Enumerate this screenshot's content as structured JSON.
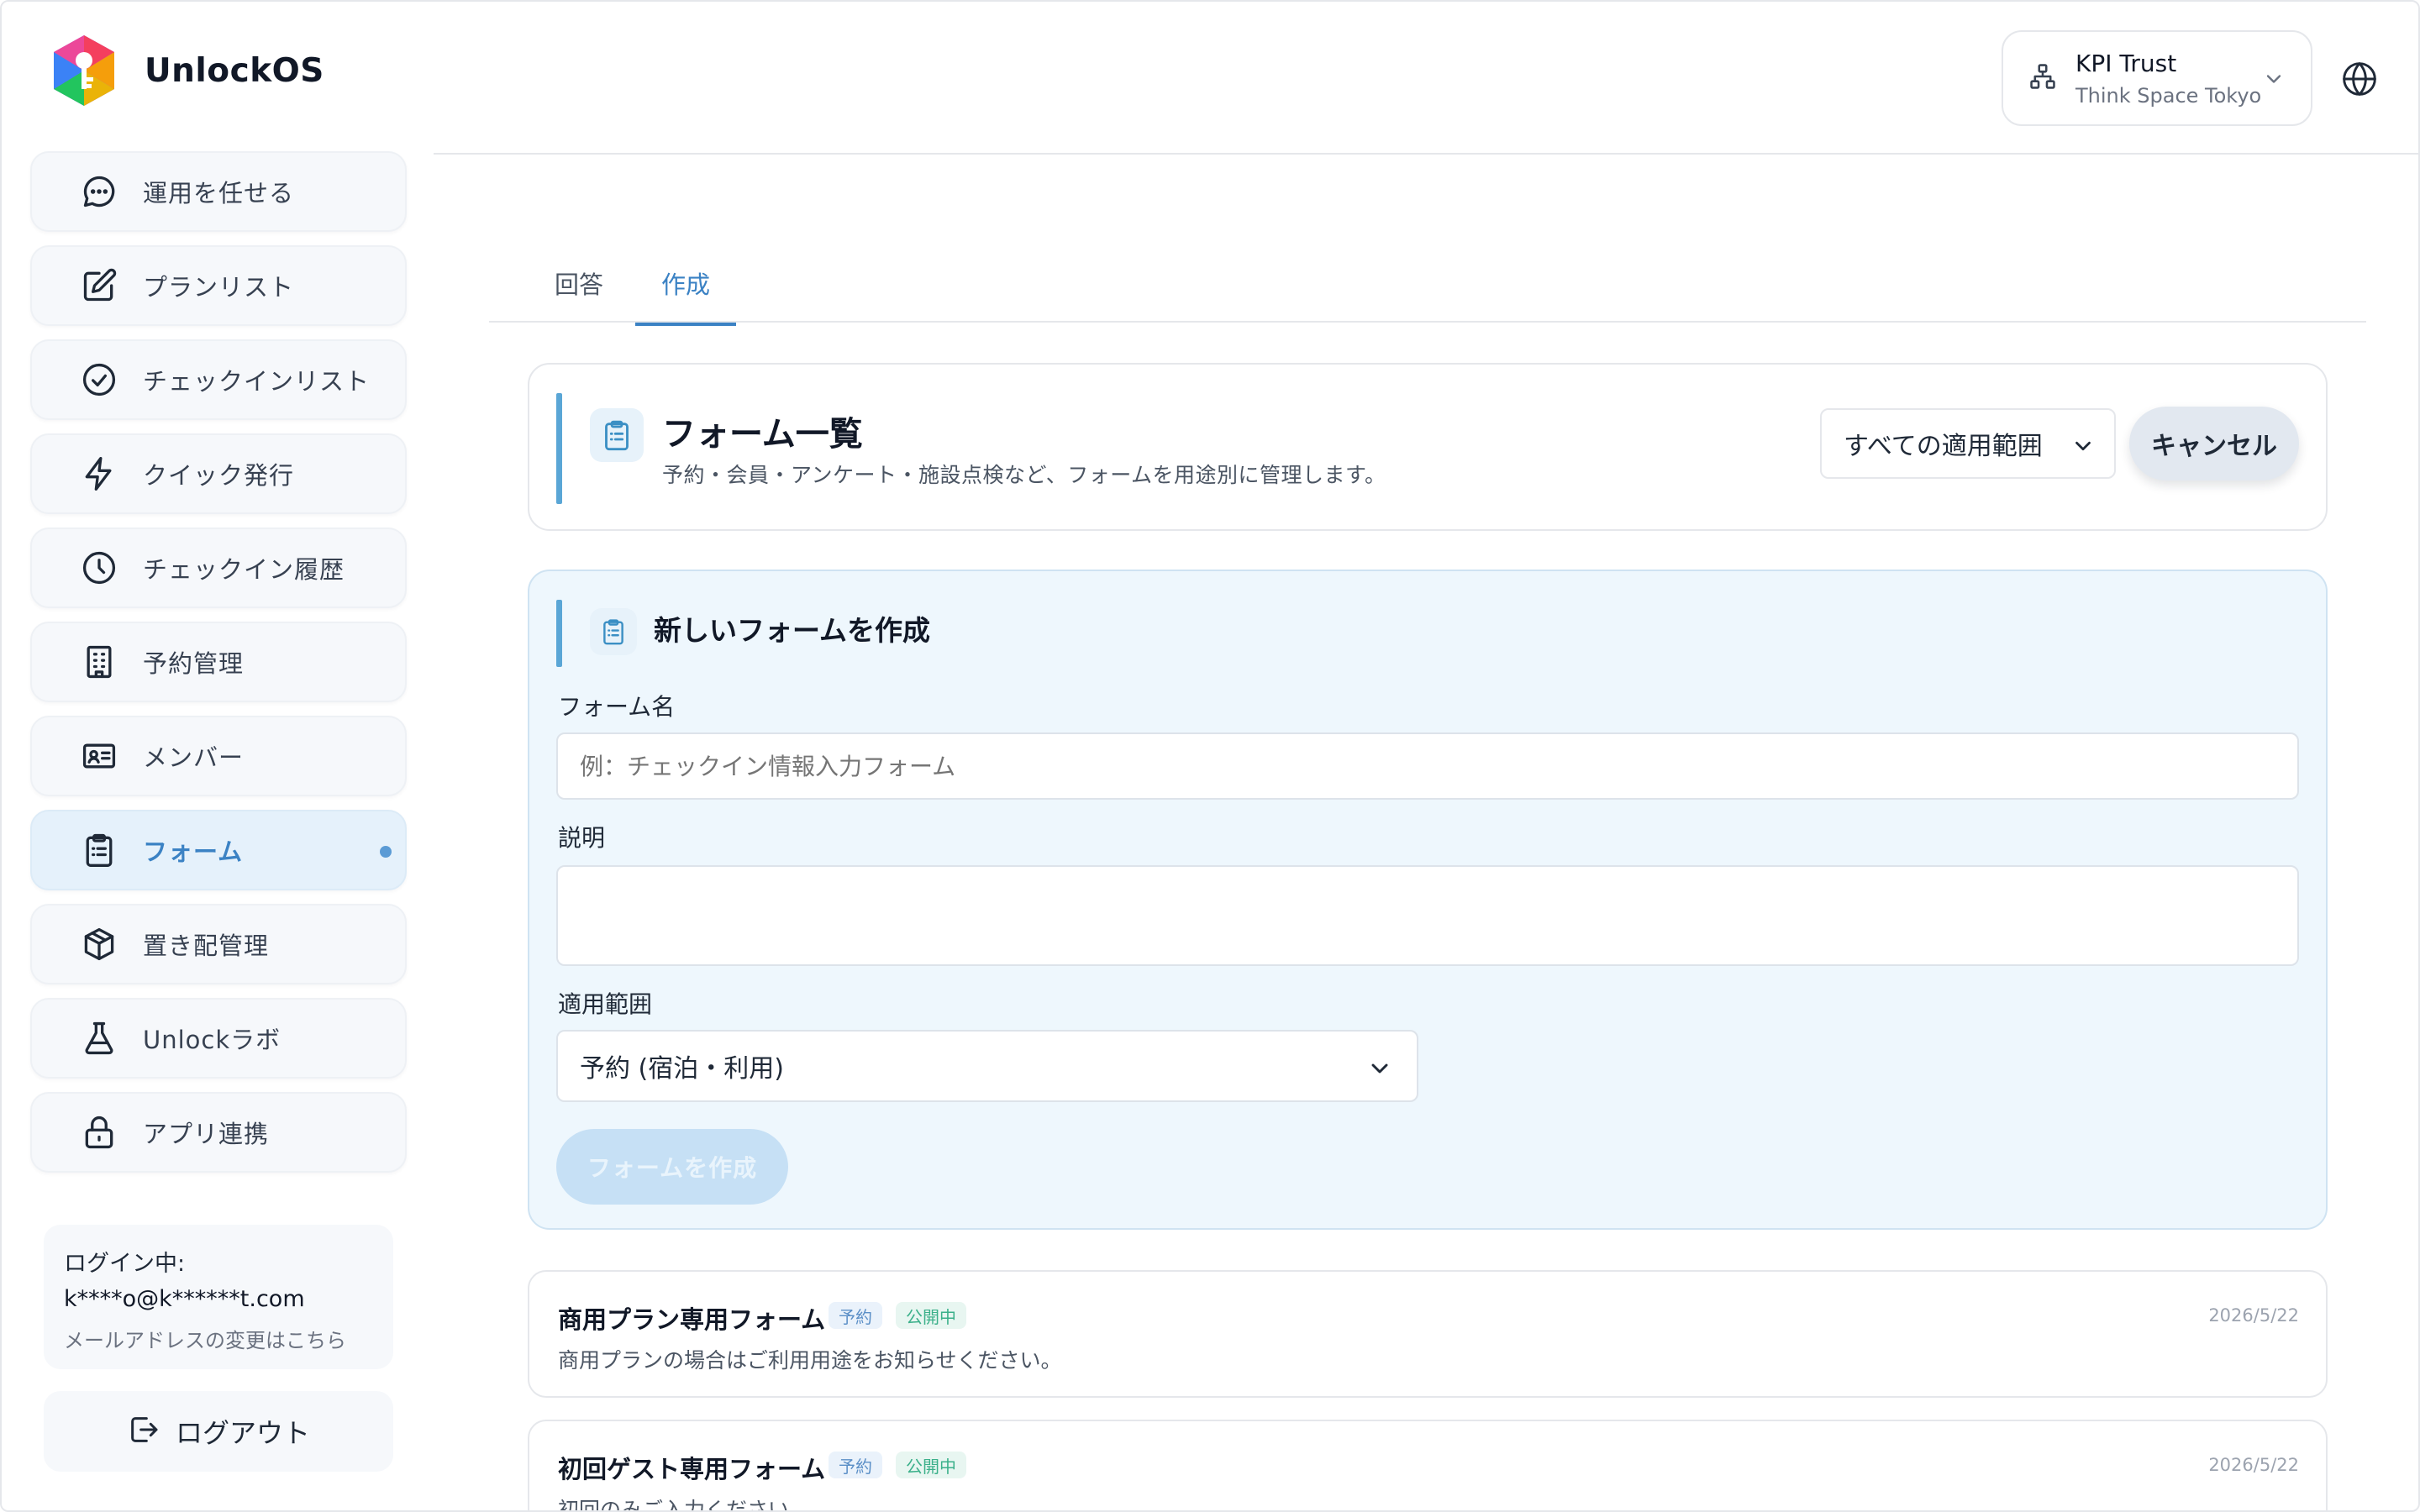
{
  "brand": {
    "name": "UnlockOS"
  },
  "org": {
    "name": "KPI Trust",
    "location": "Think Space Tokyo"
  },
  "sidebar": {
    "items": [
      {
        "label": "運用を任せる",
        "icon": "chat-icon"
      },
      {
        "label": "プランリスト",
        "icon": "edit-icon"
      },
      {
        "label": "チェックインリスト",
        "icon": "check-circle-icon"
      },
      {
        "label": "クイック発行",
        "icon": "lightning-icon"
      },
      {
        "label": "チェックイン履歴",
        "icon": "clock-icon"
      },
      {
        "label": "予約管理",
        "icon": "building-icon"
      },
      {
        "label": "メンバー",
        "icon": "id-card-icon"
      },
      {
        "label": "フォーム",
        "icon": "clipboard-icon",
        "active": true
      },
      {
        "label": "置き配管理",
        "icon": "package-icon"
      },
      {
        "label": "Unlockラボ",
        "icon": "flask-icon"
      },
      {
        "label": "アプリ連携",
        "icon": "lock-icon"
      }
    ],
    "login": {
      "label": "ログイン中:",
      "email": "k****o@k******t.com",
      "change_link": "メールアドレスの変更はこちら"
    },
    "logout_label": "ログアウト"
  },
  "tabs": [
    {
      "label": "回答",
      "active": false
    },
    {
      "label": "作成",
      "active": true
    }
  ],
  "header_card": {
    "title": "フォーム一覧",
    "description": "予約・会員・アンケート・施設点検など、フォームを用途別に管理します。",
    "scope_filter": "すべての適用範囲",
    "cancel_label": "キャンセル"
  },
  "create_form": {
    "title": "新しいフォームを作成",
    "name_label": "フォーム名",
    "name_placeholder": "例：チェックイン情報入力フォーム",
    "name_value": "",
    "description_label": "説明",
    "description_value": "",
    "scope_label": "適用範囲",
    "scope_value": "予約 (宿泊・利用)",
    "submit_label": "フォームを作成"
  },
  "forms": [
    {
      "title": "商用プラン専用フォーム",
      "tags": [
        "予約",
        "公開中"
      ],
      "date": "2026/5/22",
      "description": "商用プランの場合はご利用用途をお知らせください。"
    },
    {
      "title": "初回ゲスト専用フォーム",
      "tags": [
        "予約",
        "公開中"
      ],
      "date": "2026/5/22",
      "description": "初回のみご入力ください。"
    }
  ],
  "colors": {
    "accent": "#3b82c4",
    "accent_bar": "#5aa6d6",
    "active_nav_bg": "#e5f1fb",
    "panel_bg": "#eef7fd",
    "tag_green": "#3bb08a"
  }
}
